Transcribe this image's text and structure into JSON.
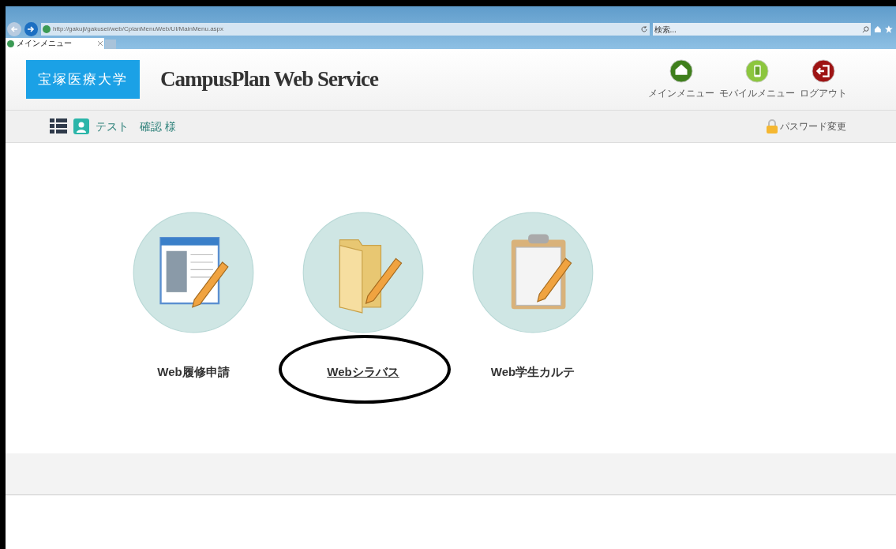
{
  "browser": {
    "address": "http://gakuji/gakusei/web/CplanMenuWeb/UI/MainMenu.aspx",
    "search": {
      "placeholder": "検索..."
    },
    "tabs": [
      {
        "label": "メインメニュー",
        "selected": true
      }
    ]
  },
  "header": {
    "logo_text": "宝塚医療大学",
    "title": "CampusPlan Web Service",
    "actions": [
      {
        "kind": "home",
        "label": "メインメニュー"
      },
      {
        "kind": "mobile",
        "label": "モバイルメニュー"
      },
      {
        "kind": "logout",
        "label": "ログアウト"
      }
    ]
  },
  "user_bar": {
    "user_name": "テスト　確認 様",
    "password_link": "パスワード変更"
  },
  "menu": [
    {
      "kind": "registration",
      "label": "Web履修申請",
      "highlighted": false
    },
    {
      "kind": "syllabus",
      "label": "Webシラバス",
      "highlighted": true
    },
    {
      "kind": "record",
      "label": "Web学生カルテ",
      "highlighted": false
    }
  ]
}
